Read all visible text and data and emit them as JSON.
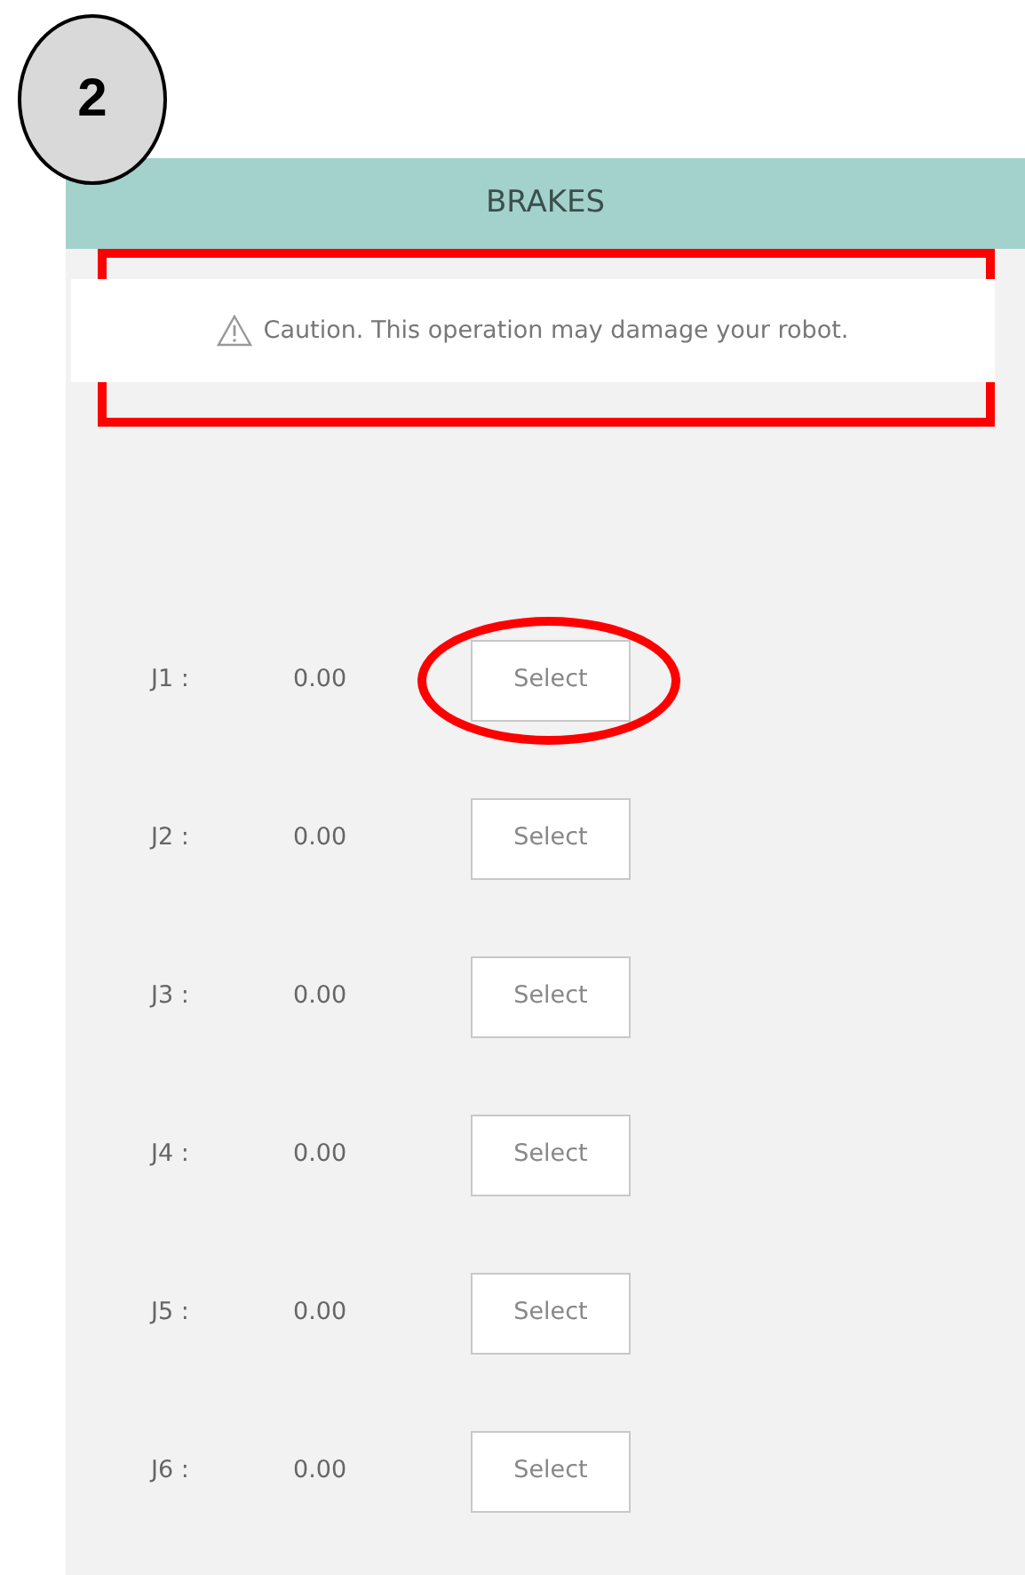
{
  "step": "2",
  "panel": {
    "title": "BRAKES",
    "caution": {
      "text": "Caution. This operation may damage your robot.",
      "highlighted": true
    },
    "joints": [
      {
        "label": "J1 :",
        "value": "0.00",
        "button": "Select",
        "highlighted": true
      },
      {
        "label": "J2 :",
        "value": "0.00",
        "button": "Select",
        "highlighted": false
      },
      {
        "label": "J3 :",
        "value": "0.00",
        "button": "Select",
        "highlighted": false
      },
      {
        "label": "J4 :",
        "value": "0.00",
        "button": "Select",
        "highlighted": false
      },
      {
        "label": "J5 :",
        "value": "0.00",
        "button": "Select",
        "highlighted": false
      },
      {
        "label": "J6 :",
        "value": "0.00",
        "button": "Select",
        "highlighted": false
      }
    ]
  }
}
